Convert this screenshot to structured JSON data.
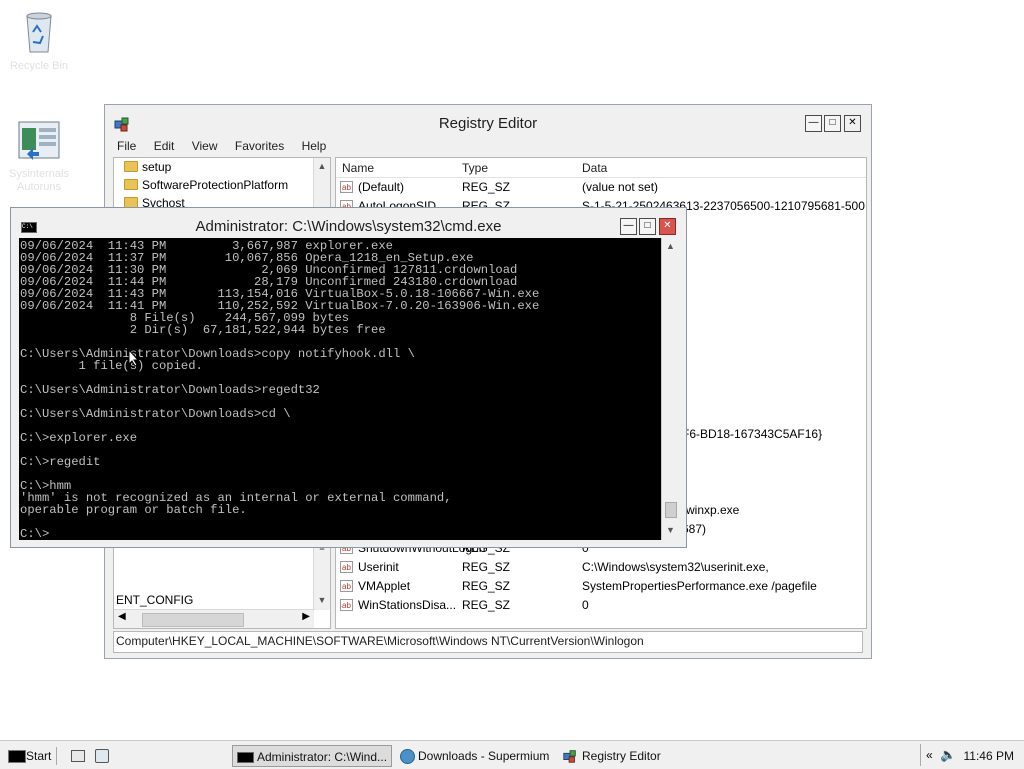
{
  "desktop": {
    "icons": [
      {
        "name": "recycle-bin",
        "label": "Recycle Bin"
      },
      {
        "name": "shortcut",
        "label": "Sysinternals Autoruns"
      }
    ]
  },
  "regedit": {
    "title": "Registry Editor",
    "menu": [
      "File",
      "Edit",
      "View",
      "Favorites",
      "Help"
    ],
    "tree_items": [
      "setup",
      "SoftwareProtectionPlatform",
      "Svchost"
    ],
    "tree_bottom_item": "ENT_CONFIG",
    "columns": {
      "name": "Name",
      "type": "Type",
      "data": "Data"
    },
    "rows_top": [
      {
        "name": "(Default)",
        "type": "REG_SZ",
        "data": "(value not set)"
      },
      {
        "name": "AutoLogonSID",
        "type": "REG_SZ",
        "data": "S-1-5-21-2502463613-2237056500-1210795681-500"
      }
    ],
    "partial_data": [
      "F6-BD18-167343C5AF16}",
      "rwinxp.exe",
      "687)"
    ],
    "rows_bottom": [
      {
        "name": "ShutdownWithoutLogon",
        "type": "REG_SZ",
        "data": "0"
      },
      {
        "name": "Userinit",
        "type": "REG_SZ",
        "data": "C:\\Windows\\system32\\userinit.exe,"
      },
      {
        "name": "VMApplet",
        "type": "REG_SZ",
        "data": "SystemPropertiesPerformance.exe /pagefile"
      },
      {
        "name": "WinStationsDisa...",
        "type": "REG_SZ",
        "data": "0"
      }
    ],
    "status_path": "Computer\\HKEY_LOCAL_MACHINE\\SOFTWARE\\Microsoft\\Windows NT\\CurrentVersion\\Winlogon"
  },
  "cmd": {
    "title": "Administrator: C:\\Windows\\system32\\cmd.exe",
    "output": "09/06/2024  11:43 PM         3,667,987 explorer.exe\n09/06/2024  11:37 PM        10,067,856 Opera_1218_en_Setup.exe\n09/06/2024  11:30 PM             2,069 Unconfirmed 127811.crdownload\n09/06/2024  11:44 PM            28,179 Unconfirmed 243180.crdownload\n09/06/2024  11:43 PM       113,154,016 VirtualBox-5.0.18-106667-Win.exe\n09/06/2024  11:41 PM       110,252,592 VirtualBox-7.0.20-163906-Win.exe\n               8 File(s)    244,567,099 bytes\n               2 Dir(s)  67,181,522,944 bytes free\n\nC:\\Users\\Administrator\\Downloads>copy notifyhook.dll \\\n        1 file(s) copied.\n\nC:\\Users\\Administrator\\Downloads>regedt32\n\nC:\\Users\\Administrator\\Downloads>cd \\\n\nC:\\>explorer.exe\n\nC:\\>regedit\n\nC:\\>hmm\n'hmm' is not recognized as an internal or external command,\noperable program or batch file.\n\nC:\\>"
  },
  "taskbar": {
    "start_label": "Start",
    "items": [
      {
        "label": "Administrator: C:\\Wind...",
        "active": true
      },
      {
        "label": "Downloads - Supermium",
        "active": false
      },
      {
        "label": "Registry Editor",
        "active": false
      }
    ],
    "clock": "11:46 PM"
  }
}
